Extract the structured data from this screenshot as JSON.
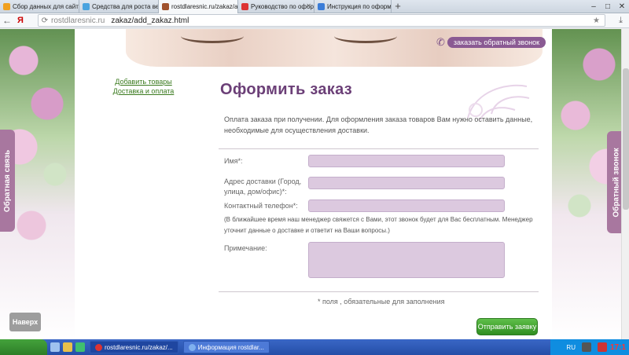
{
  "browser": {
    "tabs": [
      {
        "label": "Сбор данных для сайта",
        "favicon_color": "#f0a020"
      },
      {
        "label": "Средства для роста ве",
        "favicon_color": "#4aa3df"
      },
      {
        "label": "rostdlaresnic.ru/zakaz/a",
        "favicon_color": "#a0522d",
        "active": true
      },
      {
        "label": "Руководство по оформ",
        "favicon_color": "#d33"
      },
      {
        "label": "Инструкция по оформ",
        "favicon_color": "#3b7dd8"
      }
    ],
    "new_tab": "+",
    "window_controls": {
      "minimize": "–",
      "maximize": "□",
      "close": "✕"
    },
    "brand": "Я",
    "url_domain": "rostdlaresnic.ru",
    "url_path": "zakaz/add_zakaz.html"
  },
  "header": {
    "callback_button": "заказать обратный звонок"
  },
  "side_tabs": {
    "left": "Обратная связь",
    "right": "Обратный звонок"
  },
  "scroll_top_button": "Наверх",
  "left_links": [
    "Добавить товары",
    "Доставка и оплата"
  ],
  "main": {
    "title": "Оформить заказ",
    "intro": "Оплата заказа при получении. Для оформления заказа товаров Вам нужно оставить данные, необходимые для осуществления доставки.",
    "form": {
      "name_label": "Имя*:",
      "address_label": "Адрес доставки (Город, улица, дом/офис)*:",
      "phone_label": "Контактный телефон*:",
      "phone_note": "(В ближайшее время наш менеджер свяжется с Вами, этот звонок будет для Вас бесплатным. Менеджер уточнит данные о доставке и ответит на Ваши вопросы.)",
      "comment_label": "Примечание:",
      "required_note": "* поля , обязательные для заполнения",
      "submit_label": "Отправить заявку"
    }
  },
  "taskbar": {
    "tasks": [
      {
        "label": "rostdlaresnic.ru/zakaz/...",
        "icon_color": "#d33",
        "active": true
      },
      {
        "label": "Информация rostdlar...",
        "icon_color": "#7fb0ef",
        "active": false
      }
    ],
    "language": "RU",
    "clock": "17:1"
  },
  "colors": {
    "accent_purple": "#6b3f77",
    "input_fill": "#dcc9df",
    "submit_green": "#3a9a2a",
    "link_green": "#3a7a1e"
  }
}
